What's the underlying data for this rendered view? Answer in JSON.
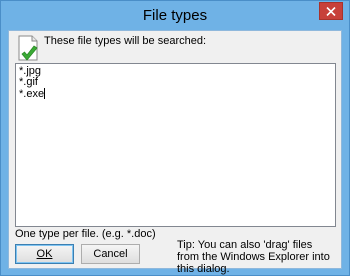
{
  "window": {
    "title": "File types"
  },
  "header": {
    "icon": "document-check-icon",
    "label": "These file types will be searched:"
  },
  "file_types": {
    "lines": [
      "*.jpg",
      "*.gif",
      "*.exe"
    ]
  },
  "hint": "One type per file. (e.g. *.doc)",
  "buttons": {
    "ok_label": "OK",
    "cancel_label": "Cancel"
  },
  "tip": "Tip: You can also 'drag' files from the Windows Explorer into this dialog.",
  "colors": {
    "titlebar": "#6fb2e6",
    "close_button": "#c7403a",
    "client": "#f0f0f0",
    "checkmark": "#3aaa35"
  }
}
